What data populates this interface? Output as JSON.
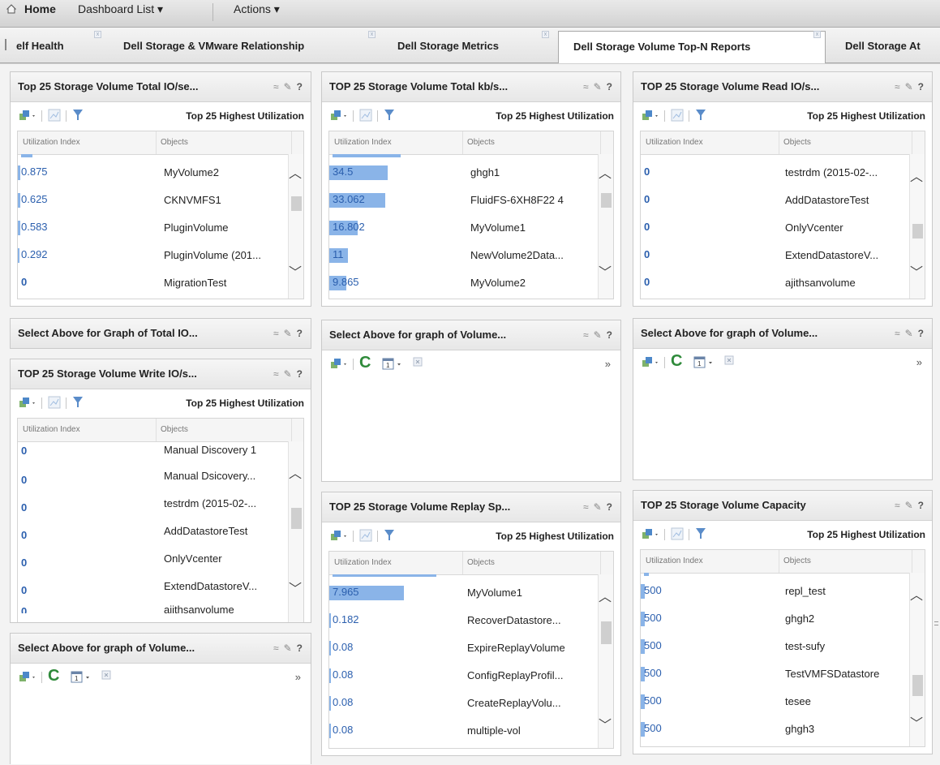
{
  "menu": {
    "home": "Home",
    "dashboard_list": "Dashboard List ▾",
    "actions": "Actions ▾"
  },
  "tabs": [
    {
      "label": "elf Health"
    },
    {
      "label": "Dell Storage & VMware Relationship"
    },
    {
      "label": "Dell Storage Metrics"
    },
    {
      "label": "Dell Storage Volume Top-N Reports"
    },
    {
      "label": "Dell Storage At"
    }
  ],
  "common": {
    "col_index": "Utilization Index",
    "col_objects": "Objects",
    "toolbar_label": "Top 25 Highest Utilization",
    "more": "»"
  },
  "portlets": {
    "p1": {
      "title": "Top 25 Storage Volume Total IO/se...",
      "rows": [
        {
          "value": "0.875",
          "object": "MyVolume2"
        },
        {
          "value": "0.625",
          "object": "CKNVMFS1"
        },
        {
          "value": "0.583",
          "object": "PluginVolume"
        },
        {
          "value": "0.292",
          "object": "PluginVolume (201..."
        },
        {
          "value": "0",
          "object": "MigrationTest"
        }
      ]
    },
    "p2": {
      "title": "TOP 25 Storage Volume Total kb/s...",
      "rows": [
        {
          "value": "34.5",
          "object": "ghgh1",
          "fill": 1.0
        },
        {
          "value": "33.062",
          "object": "FluidFS-6XH8F22 4",
          "fill": 0.958
        },
        {
          "value": "16.802",
          "object": "MyVolume1",
          "fill": 0.487
        },
        {
          "value": "11",
          "object": "NewVolume2Data...",
          "fill": 0.319
        },
        {
          "value": "9.865",
          "object": "MyVolume2",
          "fill": 0.286
        }
      ]
    },
    "p3": {
      "title": "TOP 25 Storage Volume Read IO/s...",
      "rows": [
        {
          "value": "0",
          "object": "testrdm (2015-02-..."
        },
        {
          "value": "0",
          "object": "AddDatastoreTest"
        },
        {
          "value": "0",
          "object": "OnlyVcenter"
        },
        {
          "value": "0",
          "object": "ExtendDatastoreV..."
        },
        {
          "value": "0",
          "object": "ajithsanvolume"
        }
      ]
    },
    "p4": {
      "title": "Select Above for Graph of Total IO..."
    },
    "p5": {
      "title": "Select Above for graph of Volume..."
    },
    "p6": {
      "title": "Select Above for graph of Volume..."
    },
    "p7": {
      "title": "TOP 25 Storage Volume Write IO/s...",
      "rows": [
        {
          "value": "0",
          "object": "Manual Discovery 1"
        },
        {
          "value": "0",
          "object": "Manual Dsicovery..."
        },
        {
          "value": "0",
          "object": "testrdm (2015-02-..."
        },
        {
          "value": "0",
          "object": "AddDatastoreTest"
        },
        {
          "value": "0",
          "object": "OnlyVcenter"
        },
        {
          "value": "0",
          "object": "ExtendDatastoreV..."
        },
        {
          "value": "0",
          "object": "ajithsanvolume"
        }
      ]
    },
    "p8": {
      "title": "TOP 25 Storage Volume Replay Sp...",
      "rows": [
        {
          "value": "7.965",
          "object": "MyVolume1",
          "fill": 1.0
        },
        {
          "value": "0.182",
          "object": "RecoverDatastore..."
        },
        {
          "value": "0.08",
          "object": "ExpireReplayVolume"
        },
        {
          "value": "0.08",
          "object": "ConfigReplayProfil..."
        },
        {
          "value": "0.08",
          "object": "CreateReplayVolu..."
        },
        {
          "value": "0.08",
          "object": "multiple-vol"
        }
      ]
    },
    "p9": {
      "title": "TOP 25 Storage Volume Capacity",
      "rows": [
        {
          "value": "500",
          "object": "repl_test"
        },
        {
          "value": "500",
          "object": "ghgh2"
        },
        {
          "value": "500",
          "object": "test-sufy"
        },
        {
          "value": "500",
          "object": "TestVMFSDatastore"
        },
        {
          "value": "500",
          "object": "tesee"
        },
        {
          "value": "500",
          "object": "ghgh3"
        }
      ]
    },
    "p10": {
      "title": "Select Above for graph of Volume..."
    }
  },
  "colors": {
    "bar": "#8ab4e8",
    "link": "#2b5fae"
  }
}
